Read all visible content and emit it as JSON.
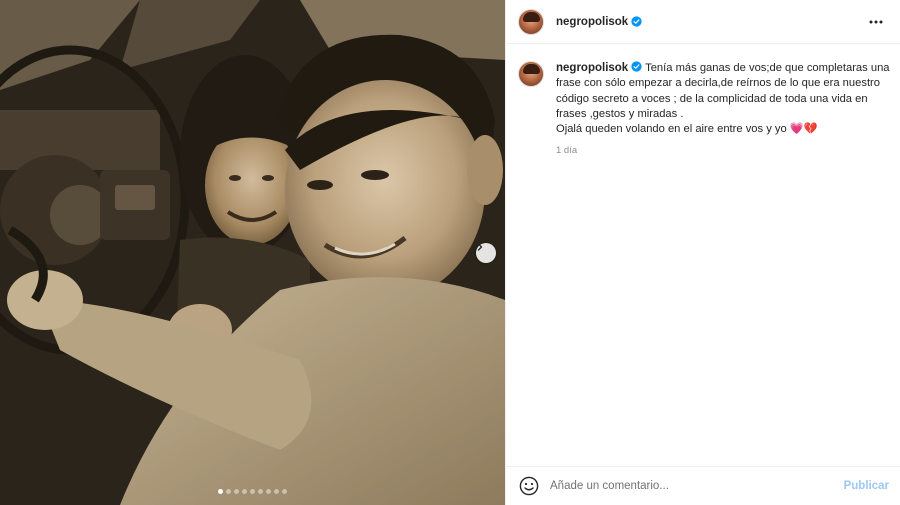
{
  "post": {
    "username": "negropolisok",
    "verified": true,
    "media": {
      "image_alt": "",
      "slide_count": 9,
      "active_slide": 1
    }
  },
  "caption": {
    "username": "negropolisok",
    "text_lines": [
      "Tenía más ganas de vos;de que completaras una",
      "frase con sólo empezar a decirla,de reírnos de lo que era nuestro",
      "código secreto a voces ; de la complicidad de toda una vida en",
      "frases ,gestos y miradas .",
      "Ojalá queden volando en el aire entre vos y yo"
    ],
    "emojis": "💗💔",
    "timestamp": "1 día"
  },
  "comment": {
    "placeholder": "Añade un comentario...",
    "publish_label": "Publicar"
  },
  "icons": {
    "verified": "verified-badge-icon",
    "more": "more-options-icon",
    "next": "chevron-right-icon",
    "emoji": "emoji-smile-icon"
  },
  "colors": {
    "verified_blue": "#0095f6",
    "publish_disabled": "#9dc7f3",
    "text": "#262626",
    "secondary": "#8e8e8e"
  }
}
